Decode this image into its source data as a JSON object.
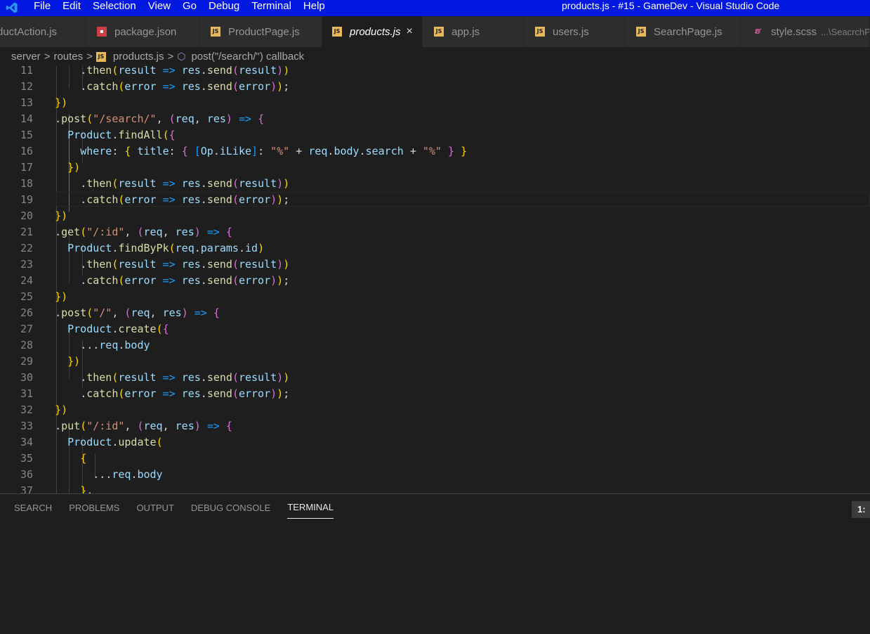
{
  "titlebar": {
    "menu": [
      "File",
      "Edit",
      "Selection",
      "View",
      "Go",
      "Debug",
      "Terminal",
      "Help"
    ],
    "window_title": "products.js - #15 - GameDev - Visual Studio Code"
  },
  "tabs": [
    {
      "label": "ductAction.js",
      "icon": "JS",
      "active": false
    },
    {
      "label": "package.json",
      "icon": "npm",
      "active": false
    },
    {
      "label": "ProductPage.js",
      "icon": "JS",
      "active": false
    },
    {
      "label": "products.js",
      "icon": "JS",
      "active": true,
      "close": "×"
    },
    {
      "label": "app.js",
      "icon": "JS",
      "active": false
    },
    {
      "label": "users.js",
      "icon": "JS",
      "active": false
    },
    {
      "label": "SearchPage.js",
      "icon": "JS",
      "active": false
    },
    {
      "label": "style.scss",
      "icon": "sass",
      "active": false,
      "description": "...\\SeacrchPa"
    }
  ],
  "breadcrumb": {
    "folder1": "server",
    "folder2": "routes",
    "file": "products.js",
    "symbol": "post(\"/search/\") callback",
    "separator": ">"
  },
  "editor": {
    "lines": [
      {
        "n": "11",
        "code": "      .then(result => res.send(result))"
      },
      {
        "n": "12",
        "code": "      .catch(error => res.send(error));"
      },
      {
        "n": "13",
        "code": "  })"
      },
      {
        "n": "14",
        "code": "  .post(\"/search/\", (req, res) => {"
      },
      {
        "n": "15",
        "code": "    Product.findAll({"
      },
      {
        "n": "16",
        "code": "      where: { title: { [Op.iLike]: \"%\" + req.body.search + \"%\" } }"
      },
      {
        "n": "17",
        "code": "    })"
      },
      {
        "n": "18",
        "code": "      .then(result => res.send(result))"
      },
      {
        "n": "19",
        "code": "      .catch(error => res.send(error));"
      },
      {
        "n": "20",
        "code": "  })"
      },
      {
        "n": "21",
        "code": "  .get(\"/:id\", (req, res) => {"
      },
      {
        "n": "22",
        "code": "    Product.findByPk(req.params.id)"
      },
      {
        "n": "23",
        "code": "      .then(result => res.send(result))"
      },
      {
        "n": "24",
        "code": "      .catch(error => res.send(error));"
      },
      {
        "n": "25",
        "code": "  })"
      },
      {
        "n": "26",
        "code": "  .post(\"/\", (req, res) => {"
      },
      {
        "n": "27",
        "code": "    Product.create({"
      },
      {
        "n": "28",
        "code": "      ...req.body"
      },
      {
        "n": "29",
        "code": "    })"
      },
      {
        "n": "30",
        "code": "      .then(result => res.send(result))"
      },
      {
        "n": "31",
        "code": "      .catch(error => res.send(error));"
      },
      {
        "n": "32",
        "code": "  })"
      },
      {
        "n": "33",
        "code": "  .put(\"/:id\", (req, res) => {"
      },
      {
        "n": "34",
        "code": "    Product.update("
      },
      {
        "n": "35",
        "code": "      {"
      },
      {
        "n": "36",
        "code": "        ...req.body"
      },
      {
        "n": "37",
        "code": "      },"
      }
    ]
  },
  "panel": {
    "tabs": [
      "SEARCH",
      "PROBLEMS",
      "OUTPUT",
      "DEBUG CONSOLE",
      "TERMINAL"
    ],
    "active_tab": "TERMINAL",
    "terminal_selector": "1:"
  },
  "colors": {
    "titlebar": "#0018e0",
    "editor_bg": "#1e1e1e",
    "tab_inactive": "#2d2d2d"
  }
}
